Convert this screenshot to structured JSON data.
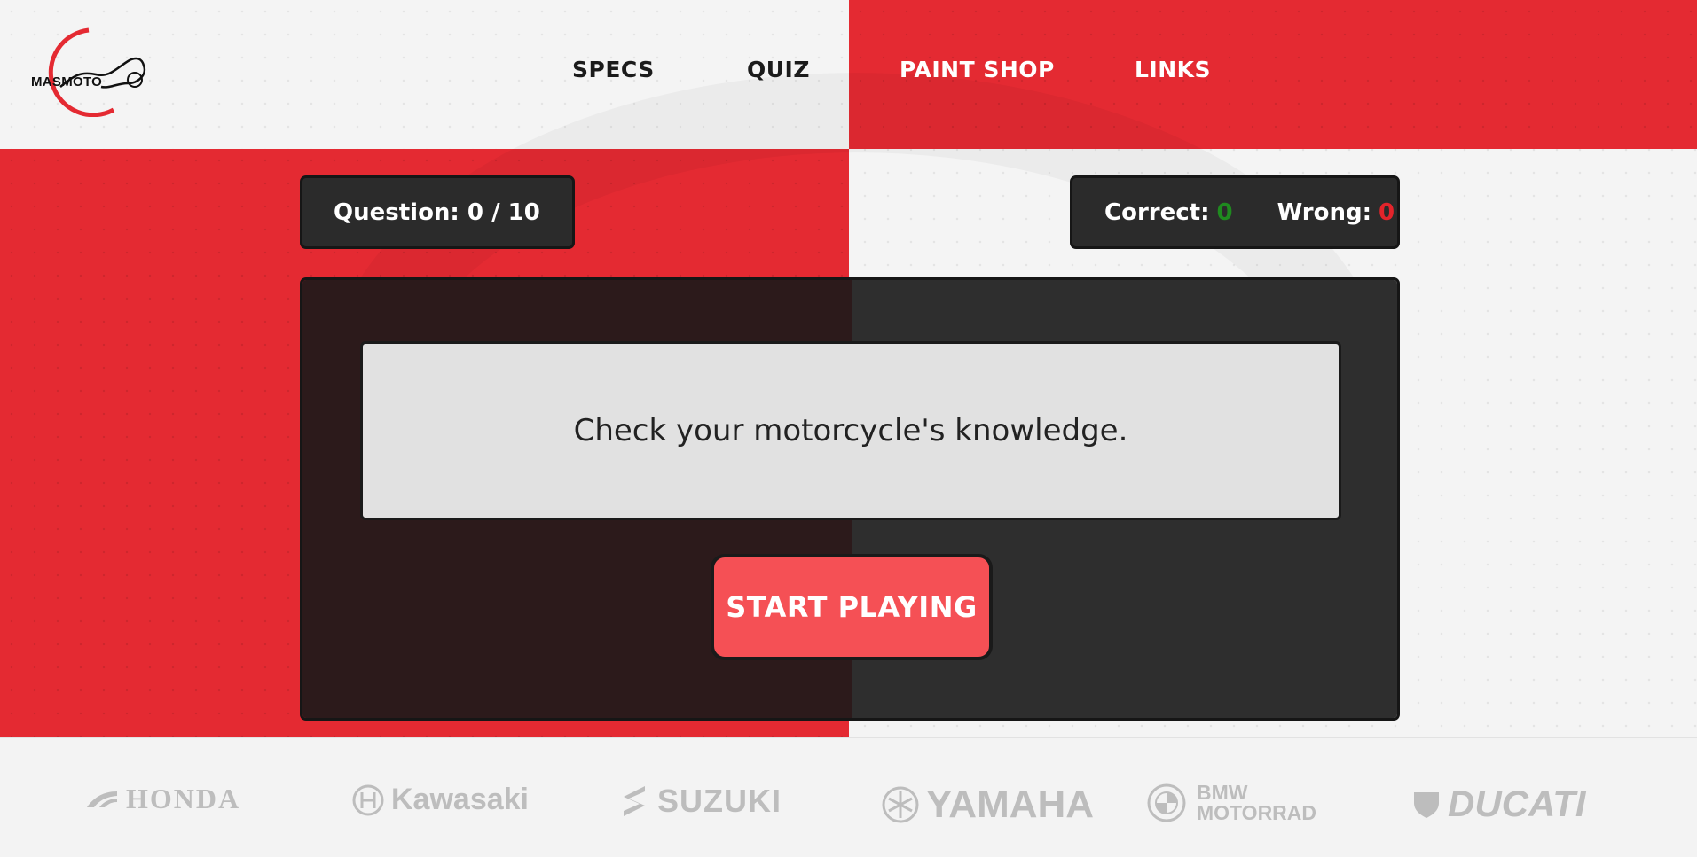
{
  "header": {
    "logo_text": "MASMOTO",
    "nav": {
      "specs": "SPECS",
      "quiz": "QUIZ",
      "paint_shop": "PAINT SHOP",
      "links": "LINKS"
    }
  },
  "quiz": {
    "question_label": "Question:",
    "question_current": "0",
    "question_separator": "/",
    "question_total": "10",
    "correct_label": "Correct:",
    "correct_count": "0",
    "wrong_label": "Wrong:",
    "wrong_count": "0",
    "message": "Check your motorcycle's knowledge.",
    "start_button": "START PLAYING"
  },
  "footer": {
    "brands": {
      "honda": "HONDA",
      "kawasaki": "Kawasaki",
      "suzuki": "SUZUKI",
      "yamaha": "YAMAHA",
      "bmw_line1": "BMW",
      "bmw_line2": "MOTORRAD",
      "ducati": "DUCATI"
    }
  },
  "colors": {
    "brand_red": "#e42a32",
    "button_red": "#f55055",
    "panel_dark": "#2e2e2e",
    "correct_green": "#1f8a1f",
    "wrong_red": "#e3242b"
  }
}
